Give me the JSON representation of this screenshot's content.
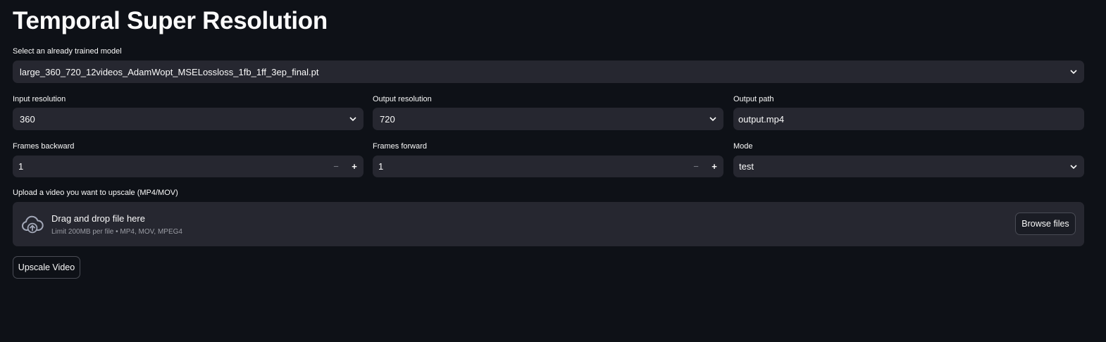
{
  "title": "Temporal Super Resolution",
  "model": {
    "label": "Select an already trained model",
    "value": "large_360_720_12videos_AdamWopt_MSELossloss_1fb_1ff_3ep_final.pt"
  },
  "input_resolution": {
    "label": "Input resolution",
    "value": "360"
  },
  "output_resolution": {
    "label": "Output resolution",
    "value": "720"
  },
  "output_path": {
    "label": "Output path",
    "value": "output.mp4"
  },
  "frames_backward": {
    "label": "Frames backward",
    "value": "1",
    "minus": "−",
    "plus": "+"
  },
  "frames_forward": {
    "label": "Frames forward",
    "value": "1",
    "minus": "−",
    "plus": "+"
  },
  "mode": {
    "label": "Mode",
    "value": "test"
  },
  "upload": {
    "label": "Upload a video you want to upscale (MP4/MOV)",
    "drop_text": "Drag and drop file here",
    "limit_text": "Limit 200MB per file • MP4, MOV, MPEG4",
    "browse_label": "Browse files",
    "icon": "cloud-upload-icon"
  },
  "upscale_button": "Upscale Video",
  "colors": {
    "background": "#0e1117",
    "input_bg": "#262730",
    "text": "#fafafa",
    "muted": "#9a9ca4"
  }
}
